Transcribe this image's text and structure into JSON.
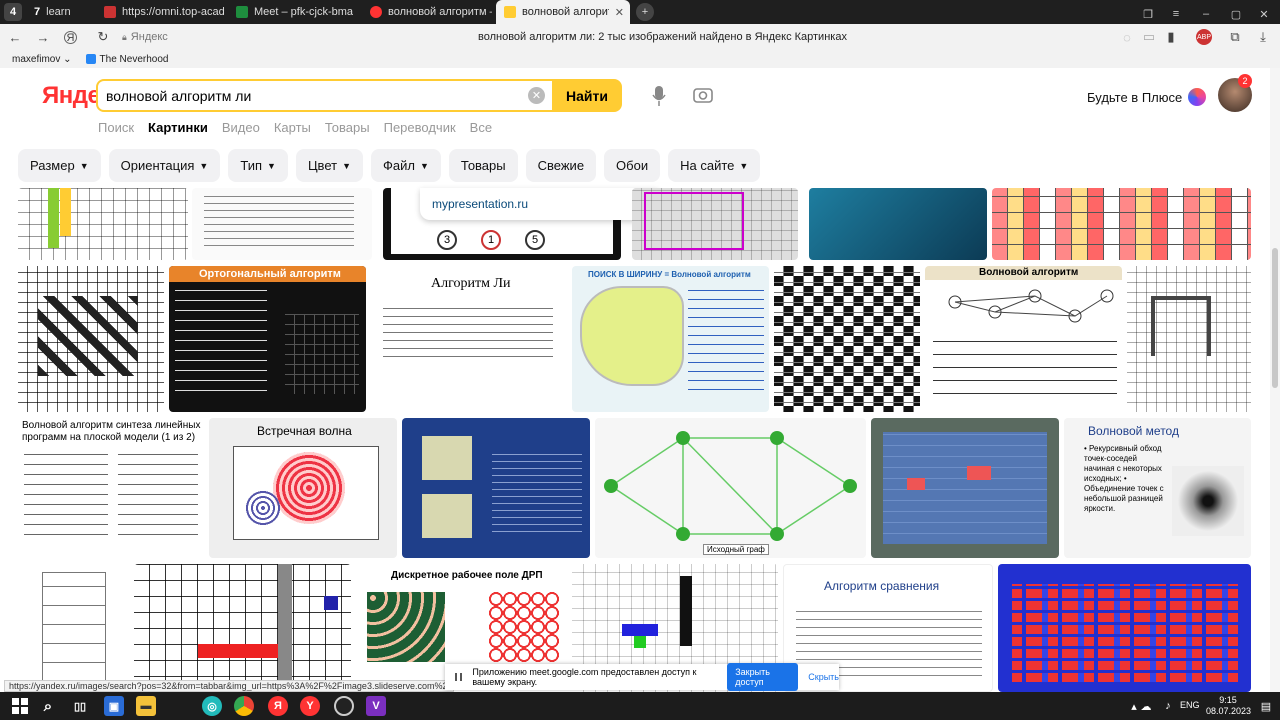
{
  "tabs": [
    {
      "label": "learn",
      "prefix": "7"
    },
    {
      "label": "https://omni.top-academy"
    },
    {
      "label": "Meet – pfk-cjck-bma"
    },
    {
      "label": "волновой алгоритм — Я"
    },
    {
      "label": "волновой алгоритм ли"
    }
  ],
  "address": {
    "site": "Яндекс",
    "page_title": "волновой алгоритм ли: 2 тыс изображений найдено в Яндекс Картинках"
  },
  "bookmarks": {
    "profile": "maxefimov",
    "item": "The Neverhood"
  },
  "header": {
    "logo": "Яндекс",
    "search_value": "волновой алгоритм ли",
    "search_button": "Найти",
    "plus_label": "Будьте в Плюсе",
    "avatar_badge": "2"
  },
  "services": [
    "Поиск",
    "Картинки",
    "Видео",
    "Карты",
    "Товары",
    "Переводчик",
    "Все"
  ],
  "active_service": "Картинки",
  "filters": [
    {
      "label": "Размер",
      "dropdown": true
    },
    {
      "label": "Ориентация",
      "dropdown": true
    },
    {
      "label": "Тип",
      "dropdown": true
    },
    {
      "label": "Цвет",
      "dropdown": true
    },
    {
      "label": "Файл",
      "dropdown": true
    },
    {
      "label": "Товары",
      "dropdown": false
    },
    {
      "label": "Свежие",
      "dropdown": false
    },
    {
      "label": "Обои",
      "dropdown": false
    },
    {
      "label": "На сайте",
      "dropdown": true
    }
  ],
  "popup": {
    "site": "mypresentation.ru"
  },
  "thumbs": {
    "t_ortho": "Ортогональный алгоритм",
    "t_li": "Алгоритм Ли",
    "t_bfs": "ПОИСК В ШИРИНУ = Волновой алгоритм",
    "t_wave": "Волновой алгоритм",
    "t_synth": "Волновой алгоритм синтеза линейных программ на плоской модели (1 из 2)",
    "t_counter": "Встречная волна",
    "t_method": "Волновой метод",
    "t_method_bullets": "• Рекурсивный обход точек-соседей начиная с некоторых исходных; • Объединение точек с небольшой разницей яркости.",
    "t_graph": "Исходный граф",
    "t_drp": "Дискретное рабочее поле ДРП",
    "t_compare": "Алгоритм сравнения"
  },
  "status_url": "https://yandex.ru/images/search?pos=32&from=tabbar&img_url=https%3A%2F%2Fimage3.slideserve.com%2F574214...",
  "notice": {
    "text": "Приложению meet.google.com предоставлен доступ к вашему экрану.",
    "access": "Закрыть доступ",
    "hide": "Скрыть"
  },
  "taskbar": {
    "lang": "ENG",
    "time": "9:15",
    "date": "08.07.2023"
  },
  "colors": {
    "brand_yellow": "#ffcc33",
    "logo_red": "#ff3333",
    "link_blue": "#1a73e8"
  }
}
